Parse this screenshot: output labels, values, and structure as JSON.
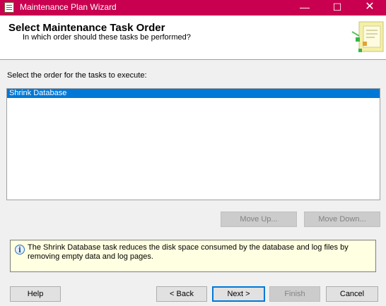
{
  "window": {
    "title": "Maintenance Plan Wizard",
    "minimize_glyph": "—",
    "maximize_glyph": "☐",
    "close_glyph": "✕"
  },
  "header": {
    "title": "Select Maintenance Task Order",
    "subtitle": "In which order should these tasks be performed?"
  },
  "body": {
    "list_label": "Select the order for the tasks to execute:",
    "tasks": [
      {
        "label": "Shrink Database",
        "selected": true
      }
    ],
    "move_up_label": "Move Up...",
    "move_down_label": "Move Down..."
  },
  "info": {
    "icon": "info-icon",
    "icon_glyph": "i",
    "text": "The Shrink Database task reduces the disk space consumed by the database and log files by removing empty data and log pages."
  },
  "footer": {
    "help_label": "Help",
    "back_label": "< Back",
    "next_label": "Next >",
    "finish_label": "Finish",
    "cancel_label": "Cancel"
  },
  "colors": {
    "titlebar": "#c8004f",
    "selection": "#0078d7",
    "info_background": "#ffffe1"
  }
}
